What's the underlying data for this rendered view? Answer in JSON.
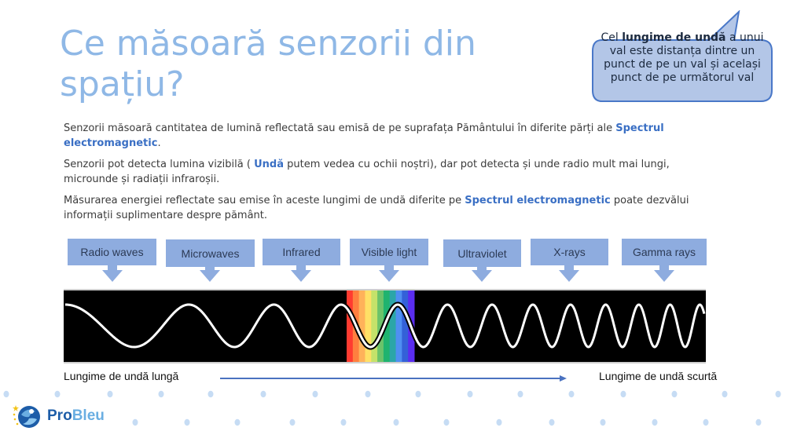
{
  "title": "Ce măsoară senzorii din spațiu?",
  "callout": {
    "prefix": "Cel ",
    "bold": "lungime de undă",
    "suffix": " a unui val este distanța dintre un punct de pe un val și același punct de pe următorul val"
  },
  "paragraphs": [
    {
      "before": "Senzorii măsoară cantitatea de lumină reflectată sau emisă de pe suprafața Pământului în diferite părți ale ",
      "highlight": "Spectrul electromagnetic",
      "after": "."
    },
    {
      "before": "Senzorii pot detecta lumina vizibilă ( ",
      "highlight": "Undă",
      "after": " putem vedea cu ochii noștri), dar pot detecta și unde radio mult mai lungi, microunde și radiații infraroșii."
    },
    {
      "before": "Măsurarea energiei reflectate sau emise în aceste lungimi de undă diferite pe ",
      "highlight": "Spectrul electromagnetic",
      "after": " poate dezvălui informații suplimentare despre pământ."
    }
  ],
  "bands": [
    {
      "label": "Radio waves"
    },
    {
      "label": "Microwaves"
    },
    {
      "label": "Infrared"
    },
    {
      "label": "Visible light"
    },
    {
      "label": "Ultraviolet"
    },
    {
      "label": "X-rays"
    },
    {
      "label": "Gamma rays"
    }
  ],
  "visible_colors": [
    "#ff3b30",
    "#ff7f3f",
    "#ffb25a",
    "#ffe066",
    "#c5e26a",
    "#6cc36a",
    "#1fb36f",
    "#2ba6a8",
    "#4f8ff2",
    "#3461d8",
    "#5a2df0"
  ],
  "axis": {
    "left_label": "Lungime de undă lungă",
    "right_label": "Lungime de undă scurtă"
  },
  "logo": {
    "pro": "Pro",
    "bleu": "Bleu"
  },
  "colors": {
    "title": "#8fb8e6",
    "highlight": "#3a6fc4",
    "band_box": "#8eacdf",
    "callout_fill": "#b3c6e7",
    "callout_stroke": "#4a78c8",
    "arrow": "#4a72c0"
  }
}
